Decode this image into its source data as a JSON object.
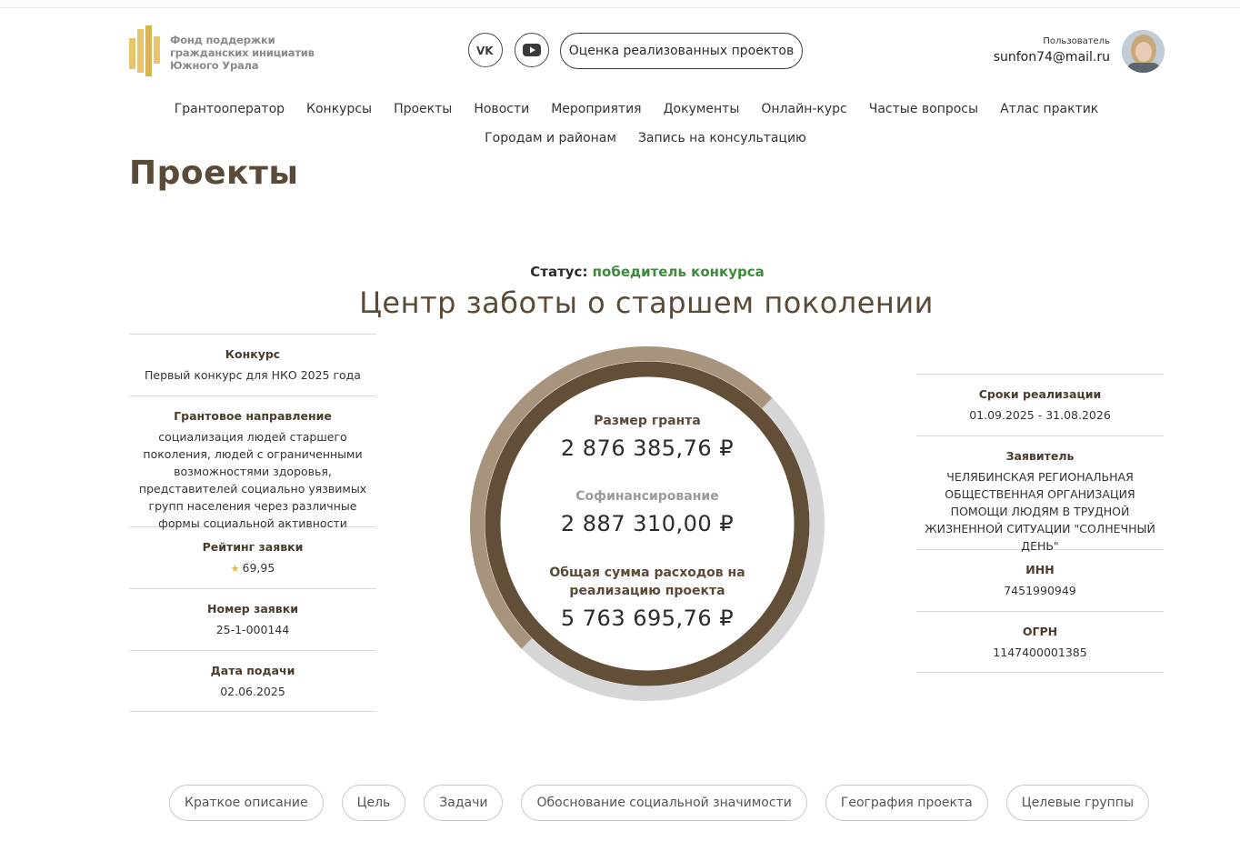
{
  "brand": {
    "line1": "Фонд поддержки",
    "line2": "гражданских инициатив",
    "line3": "Южного Урала",
    "accent": "#e8c46a"
  },
  "header": {
    "eval_button": "Оценка реализованных проектов",
    "social": [
      "vk-icon",
      "youtube-icon"
    ],
    "user_role": "Пользователь",
    "user_email": "sunfon74@mail.ru"
  },
  "nav": {
    "row1": [
      "Грантооператор",
      "Конкурсы",
      "Проекты",
      "Новости",
      "Мероприятия",
      "Документы",
      "Онлайн-курс",
      "Частые вопросы",
      "Атлас практик"
    ],
    "row2": [
      "Городам и районам",
      "Запись на консультацию"
    ]
  },
  "page_title": "Проекты",
  "status": {
    "label": "Статус:",
    "value": "победитель конкурса",
    "color": "#3d8a3d"
  },
  "project_title": "Центр заботы о старшем поколении",
  "left": {
    "contest_h": "Конкурс",
    "contest_v": "Первый конкурс для НКО 2025 года",
    "direction_h": "Грантовое направление",
    "direction_v": "социализация людей старшего поколения, людей с ограниченными возможностями здоровья, представителей социально уязвимых групп населения через различные формы социальной активности",
    "rating_h": "Рейтинг заявки",
    "rating_v": "69,95",
    "number_h": "Номер заявки",
    "number_v": "25-1-000144",
    "date_h": "Дата подачи",
    "date_v": "02.06.2025"
  },
  "right": {
    "period_h": "Сроки реализации",
    "period_v": "01.09.2025 - 31.08.2026",
    "applicant_h": "Заявитель",
    "applicant_v": "ЧЕЛЯБИНСКАЯ РЕГИОНАЛЬНАЯ ОБЩЕСТВЕННАЯ ОРГАНИЗАЦИЯ ПОМОЩИ ЛЮДЯМ В ТРУДНОЙ ЖИЗНЕННОЙ СИТУАЦИИ \"СОЛНЕЧНЫЙ ДЕНЬ\"",
    "inn_h": "ИНН",
    "inn_v": "7451990949",
    "ogrn_h": "ОГРН",
    "ogrn_v": "1147400001385"
  },
  "finance": {
    "grant_label": "Размер гранта",
    "grant_value": "2 876 385,76 ₽",
    "cofin_label": "Софинансирование",
    "cofin_value": "2 887 310,00 ₽",
    "total_label_1": "Общая сумма расходов на",
    "total_label_2": "реализацию проекта",
    "total_value": "5 763 695,76 ₽",
    "grant_share": 0.499,
    "colors": {
      "inner": "#634e37",
      "outer": "#a8937d",
      "track": "#d6d6d6"
    }
  },
  "tabs": [
    "Краткое описание",
    "Цель",
    "Задачи",
    "Обоснование социальной значимости",
    "География проекта",
    "Целевые группы"
  ]
}
